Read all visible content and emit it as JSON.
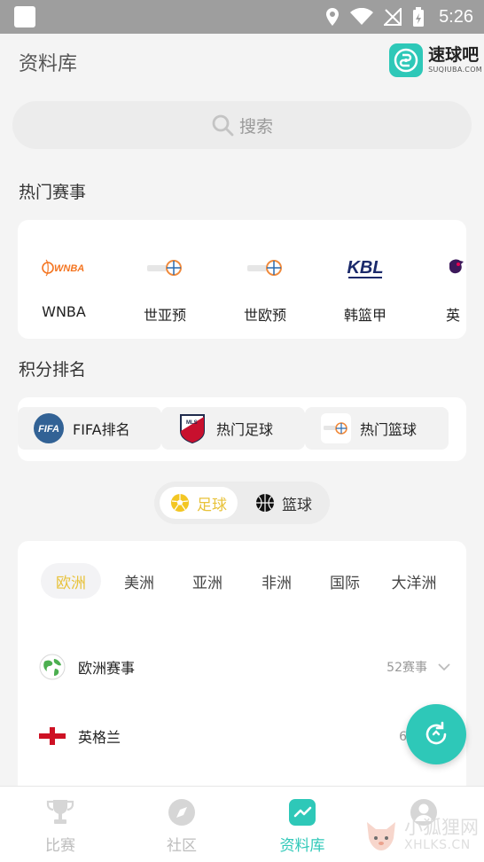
{
  "status_bar": {
    "time": "5:26"
  },
  "header": {
    "title": "资料库",
    "brand_name": "速球吧",
    "brand_url": "SUQIUBA.COM"
  },
  "search": {
    "placeholder": "搜索"
  },
  "hot_events": {
    "title": "热门赛事",
    "items": [
      {
        "label": "WNBA",
        "logo_text": "WNBA"
      },
      {
        "label": "世亚预"
      },
      {
        "label": "世欧预"
      },
      {
        "label": "韩篮甲",
        "logo_text": "KBL"
      },
      {
        "label": "英"
      }
    ]
  },
  "rankings": {
    "title": "积分排名",
    "items": [
      {
        "label": "FIFA排名",
        "logo_text": "FIFA"
      },
      {
        "label": "热门足球",
        "logo_text": "MLS"
      },
      {
        "label": "热门篮球"
      }
    ]
  },
  "sport_toggle": {
    "options": [
      {
        "label": "足球",
        "active": true
      },
      {
        "label": "篮球",
        "active": false
      }
    ]
  },
  "region_tabs": [
    "欧洲",
    "美洲",
    "亚洲",
    "非洲",
    "国际",
    "大洋洲"
  ],
  "region_list": [
    {
      "label": "欧洲赛事",
      "count": "52赛事"
    },
    {
      "label": "英格兰",
      "count": "60赛"
    }
  ],
  "bottom_nav": [
    {
      "label": "比赛",
      "active": false
    },
    {
      "label": "社区",
      "active": false
    },
    {
      "label": "资料库",
      "active": true
    },
    {
      "label": "我的",
      "active": false
    }
  ],
  "watermark": {
    "cn": "小狐狸网",
    "en": "XHLKS.CN"
  },
  "colors": {
    "accent": "#2ec8b8",
    "active_tab": "#e8c23a",
    "background": "#f4f4f4"
  }
}
